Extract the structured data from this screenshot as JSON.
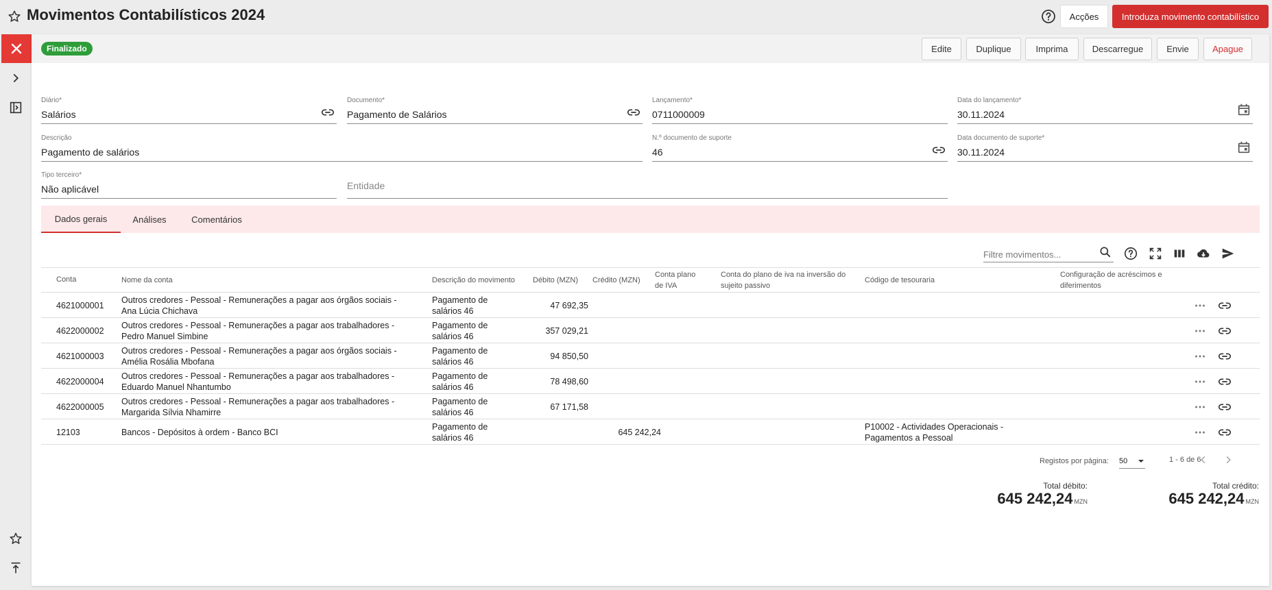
{
  "header": {
    "title": "Movimentos Contabilísticos 2024",
    "acoes_label": "Acções",
    "introduza_label": "Introduza movimento contabilístico"
  },
  "status": {
    "badge": "Finalizado"
  },
  "actions": {
    "edite": "Edite",
    "duplique": "Duplique",
    "imprima": "Imprima",
    "descarregue": "Descarregue",
    "envie": "Envie",
    "apague": "Apague"
  },
  "form": {
    "diario": {
      "label": "Diário*",
      "value": "Salários"
    },
    "documento": {
      "label": "Documento*",
      "value": "Pagamento de Salários"
    },
    "lancamento": {
      "label": "Lançamento*",
      "value": "0711000009"
    },
    "data_lancamento": {
      "label": "Data do lançamento*",
      "value": "30.11.2024"
    },
    "descricao": {
      "label": "Descrição",
      "value": "Pagamento de salários"
    },
    "num_doc_suporte": {
      "label": "N.º documento de suporte",
      "value": "46"
    },
    "data_doc_suporte": {
      "label": "Data documento de suporte*",
      "value": "30.11.2024"
    },
    "tipo_terceiro": {
      "label": "Tipo terceiro*",
      "value": "Não aplicável"
    },
    "entidade": {
      "placeholder": "Entidade"
    }
  },
  "tabs": [
    "Dados gerais",
    "Análises",
    "Comentários"
  ],
  "table": {
    "filter_placeholder": "Filtre movimentos...",
    "columns": {
      "conta": "Conta",
      "nome": "Nome da conta",
      "descricao": "Descrição do movimento",
      "debito": "Débito (MZN)",
      "credito": "Crédito (MZN)",
      "plano_iva_1": "Conta plano",
      "plano_iva_2": "de IVA",
      "inversao_1": "Conta do plano de iva na inversão do",
      "inversao_2": "sujeito passivo",
      "tesouraria": "Código de tesouraria",
      "config_1": "Configuração de acréscimos e",
      "config_2": "diferimentos"
    },
    "rows": [
      {
        "conta": "4621000001",
        "nome1": "Outros credores - Pessoal - Remunerações a pagar aos órgãos sociais -",
        "nome2": "Ana Lúcia Chichava",
        "desc1": "Pagamento de",
        "desc2": "salários 46",
        "debito": "47 692,35",
        "credito": "",
        "tes1": "",
        "tes2": ""
      },
      {
        "conta": "4622000002",
        "nome1": "Outros credores - Pessoal - Remunerações a pagar aos trabalhadores -",
        "nome2": "Pedro Manuel Simbine",
        "desc1": "Pagamento de",
        "desc2": "salários 46",
        "debito": "357 029,21",
        "credito": "",
        "tes1": "",
        "tes2": ""
      },
      {
        "conta": "4621000003",
        "nome1": "Outros credores - Pessoal - Remunerações a pagar aos órgãos sociais -",
        "nome2": "Amélia Rosália Mbofana",
        "desc1": "Pagamento de",
        "desc2": "salários 46",
        "debito": "94 850,50",
        "credito": "",
        "tes1": "",
        "tes2": ""
      },
      {
        "conta": "4622000004",
        "nome1": "Outros credores - Pessoal - Remunerações a pagar aos trabalhadores -",
        "nome2": "Eduardo Manuel Nhantumbo",
        "desc1": "Pagamento de",
        "desc2": "salários 46",
        "debito": "78 498,60",
        "credito": "",
        "tes1": "",
        "tes2": ""
      },
      {
        "conta": "4622000005",
        "nome1": "Outros credores - Pessoal - Remunerações a pagar aos trabalhadores -",
        "nome2": "Margarida Sílvia Nhamirre",
        "desc1": "Pagamento de",
        "desc2": "salários 46",
        "debito": "67 171,58",
        "credito": "",
        "tes1": "",
        "tes2": ""
      },
      {
        "conta": "12103",
        "nome1": "Bancos - Depósitos à ordem - Banco BCI",
        "nome2": "",
        "desc1": "Pagamento de",
        "desc2": "salários 46",
        "debito": "",
        "credito": "645 242,24",
        "tes1": "P10002 - Actividades Operacionais -",
        "tes2": "Pagamentos a Pessoal"
      }
    ]
  },
  "pagination": {
    "label": "Registos por página:",
    "per_page": "50",
    "range": "1 - 6 de 6"
  },
  "totals": {
    "debito_label": "Total débito:",
    "debito_value": "645 242,24",
    "credito_label": "Total crédito:",
    "credito_value": "645 242,24",
    "currency": "MZN"
  },
  "colors": {
    "accent": "#d32f2f",
    "success": "#2e9d3a",
    "tab_bg": "#fde9ea"
  }
}
